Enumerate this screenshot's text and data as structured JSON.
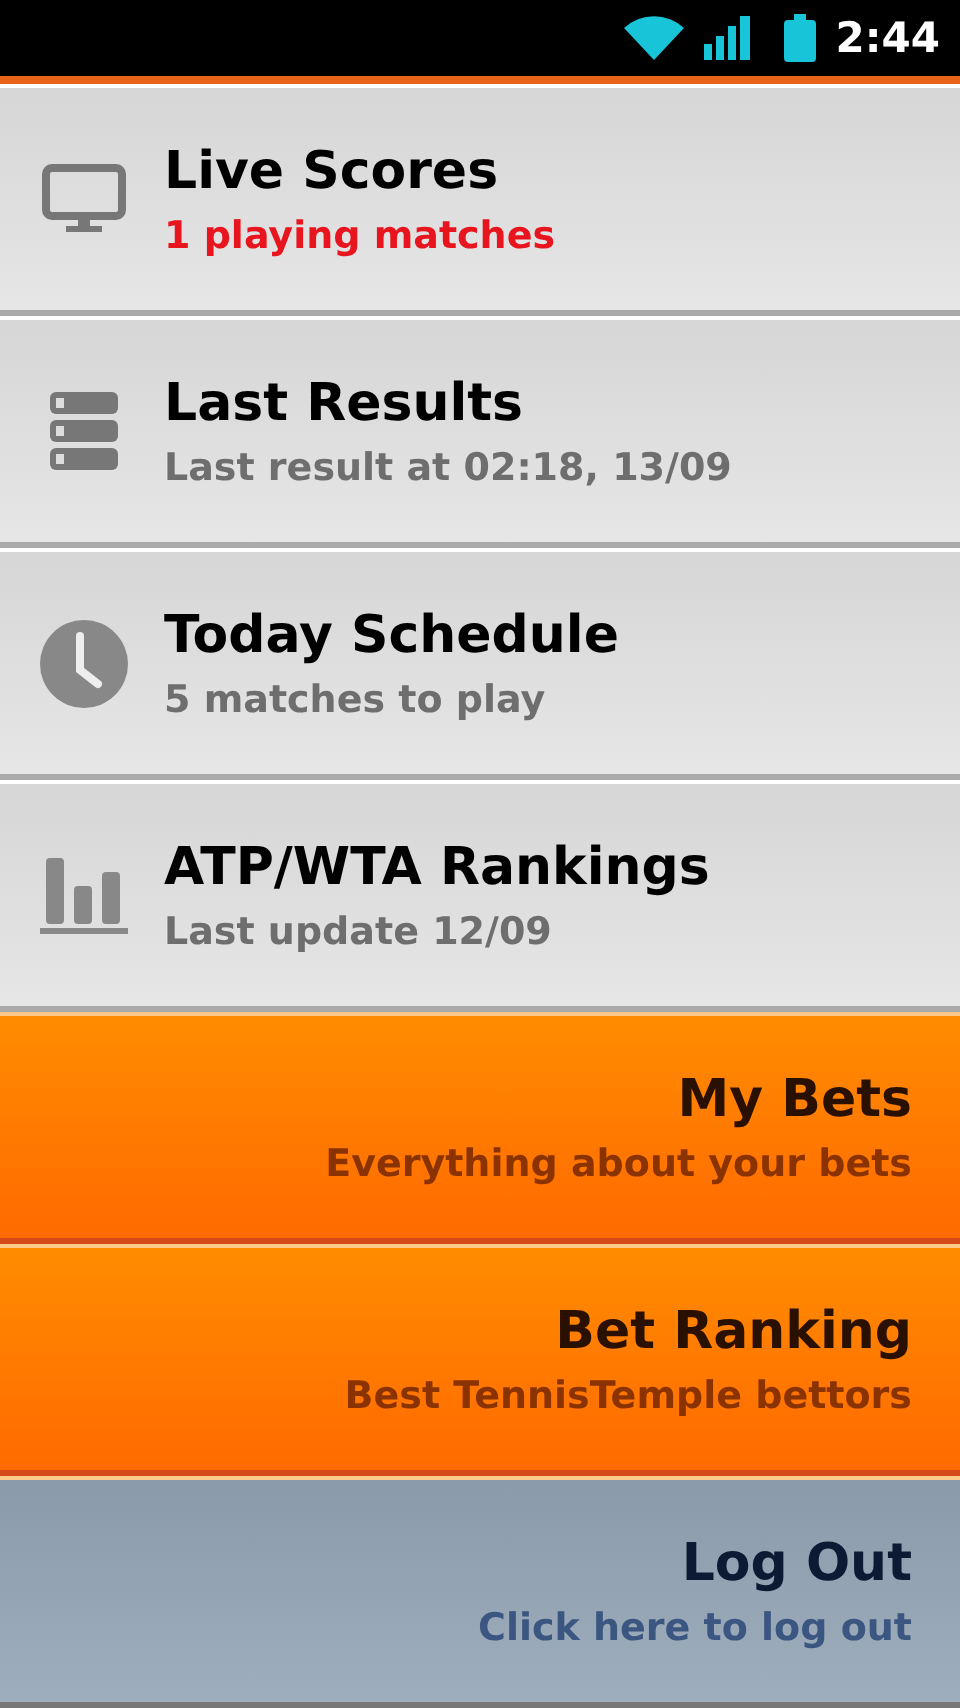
{
  "status_bar": {
    "time": "2:44"
  },
  "menu": [
    {
      "kind": "gray",
      "title": "Live Scores",
      "subtitle": "1 playing matches",
      "highlight": true
    },
    {
      "kind": "gray",
      "title": "Last Results",
      "subtitle": "Last result at 02:18, 13/09",
      "highlight": false
    },
    {
      "kind": "gray",
      "title": "Today Schedule",
      "subtitle": "5 matches to play",
      "highlight": false
    },
    {
      "kind": "gray",
      "title": "ATP/WTA Rankings",
      "subtitle": "Last update 12/09",
      "highlight": false
    },
    {
      "kind": "orange",
      "title": "My Bets",
      "subtitle": "Everything about your bets"
    },
    {
      "kind": "orange",
      "title": "Bet Ranking",
      "subtitle": "Best TennisTemple bettors"
    },
    {
      "kind": "slate",
      "title": "Log Out",
      "subtitle": "Click here to log out"
    }
  ]
}
